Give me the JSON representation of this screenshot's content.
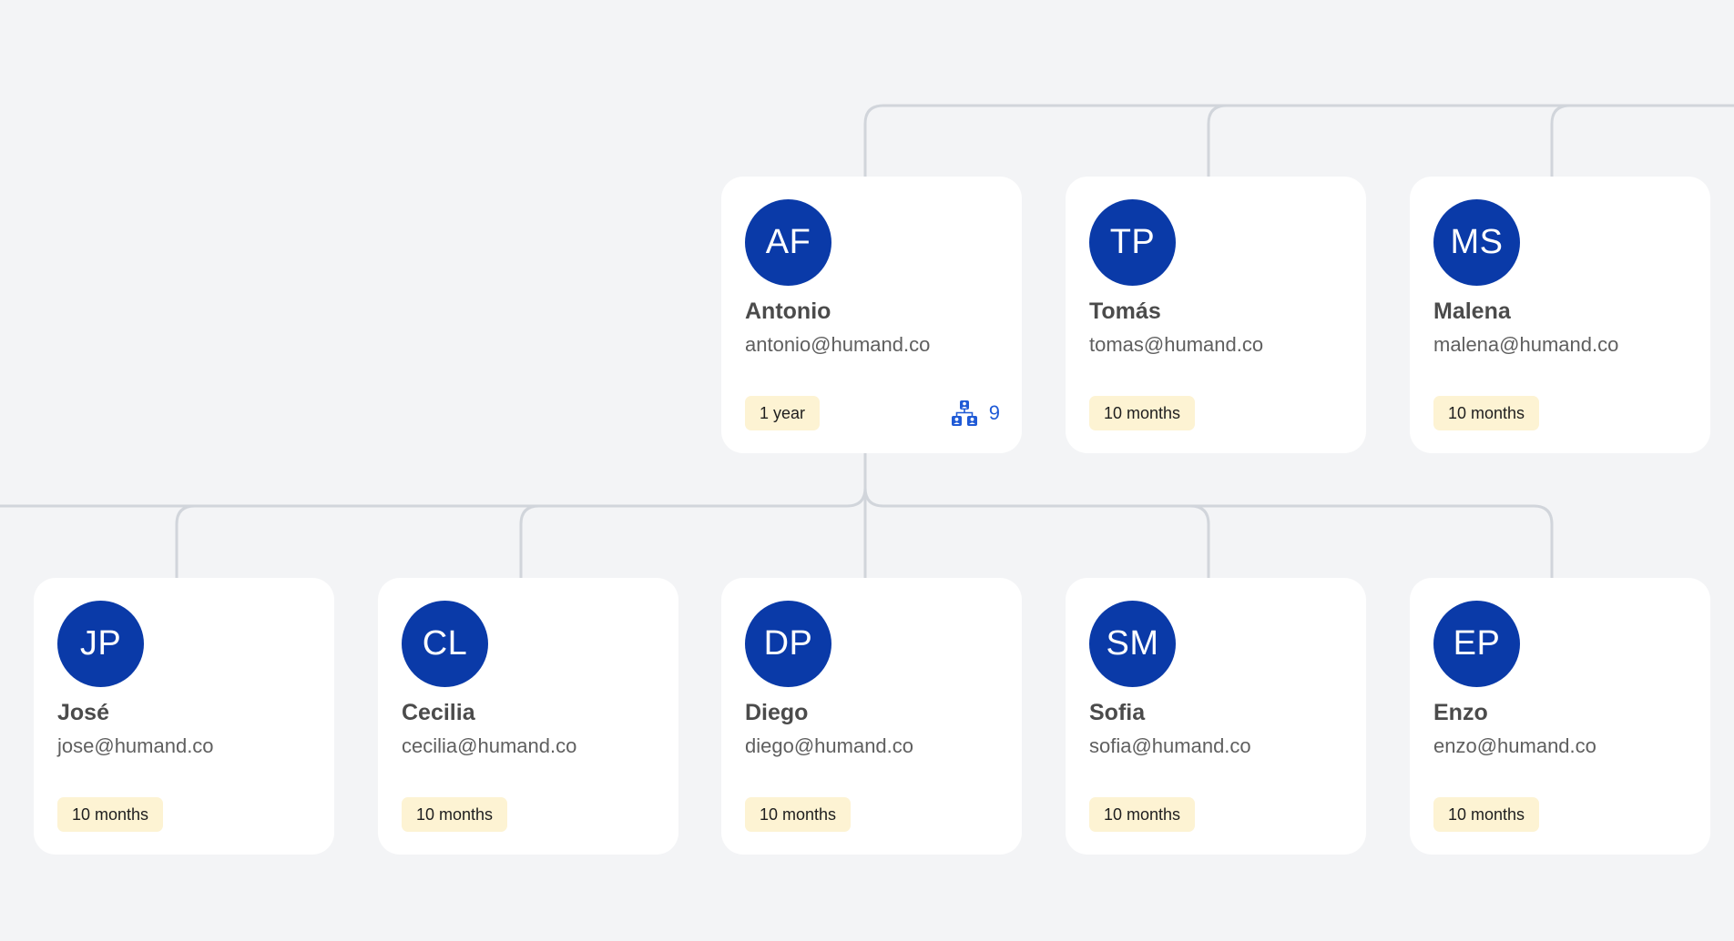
{
  "colors": {
    "avatar": "#0a3aa8",
    "badge_bg": "#fdf3d3",
    "link_blue": "#1f5ad6",
    "connector": "#d1d5db",
    "background": "#f3f4f6"
  },
  "top_row": [
    {
      "initials": "AF",
      "name": "Antonio",
      "email": "antonio@humand.co",
      "tenure": "1 year",
      "direct_reports": "9",
      "reports_icon": "org-chart-icon"
    },
    {
      "initials": "TP",
      "name": "Tomás",
      "email": "tomas@humand.co",
      "tenure": "10 months"
    },
    {
      "initials": "MS",
      "name": "Malena",
      "email": "malena@humand.co",
      "tenure": "10 months"
    }
  ],
  "bottom_row": [
    {
      "initials": "JP",
      "name": "José",
      "email": "jose@humand.co",
      "tenure": "10 months"
    },
    {
      "initials": "CL",
      "name": "Cecilia",
      "email": "cecilia@humand.co",
      "tenure": "10 months"
    },
    {
      "initials": "DP",
      "name": "Diego",
      "email": "diego@humand.co",
      "tenure": "10 months"
    },
    {
      "initials": "SM",
      "name": "Sofia",
      "email": "sofia@humand.co",
      "tenure": "10 months"
    },
    {
      "initials": "EP",
      "name": "Enzo",
      "email": "enzo@humand.co",
      "tenure": "10 months"
    }
  ]
}
